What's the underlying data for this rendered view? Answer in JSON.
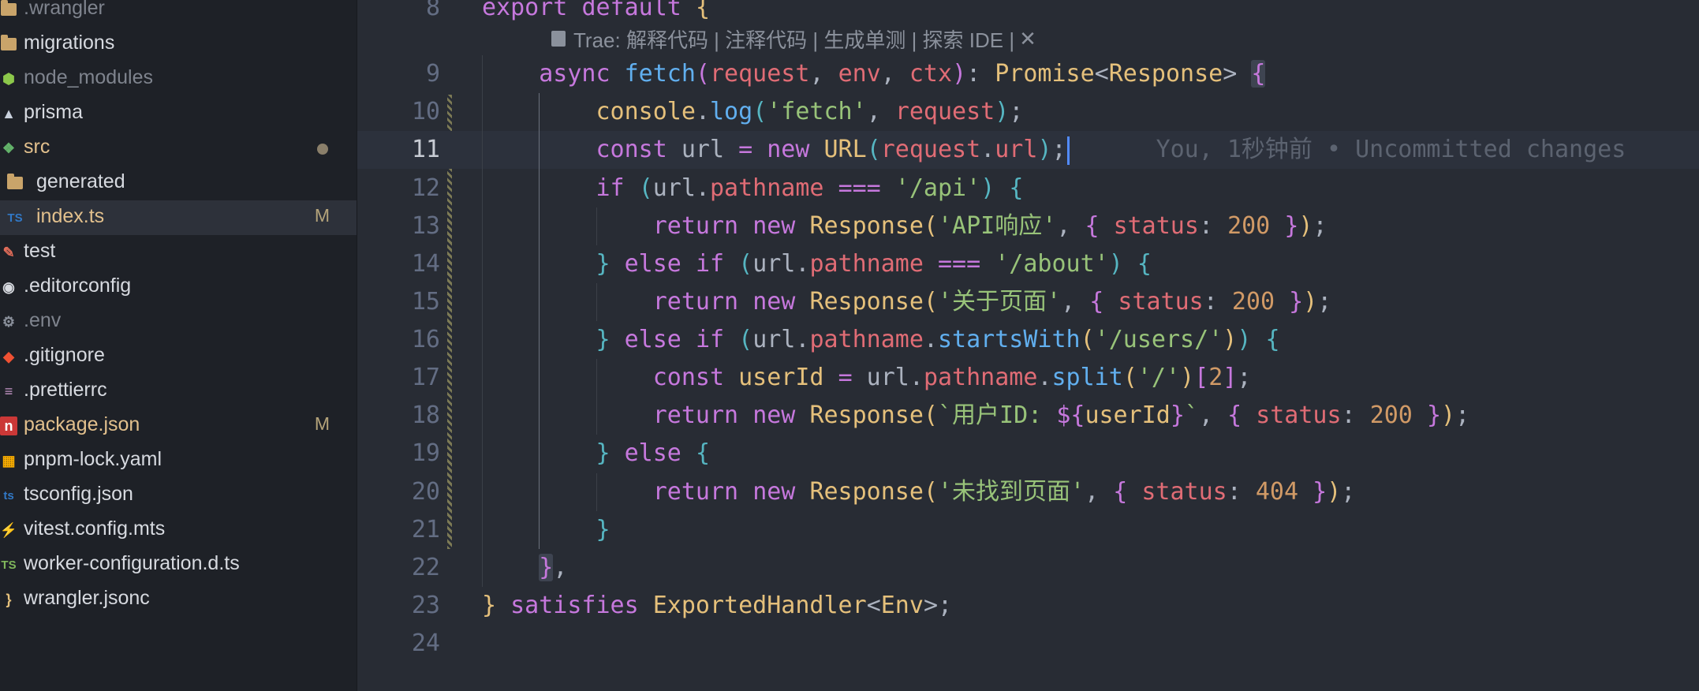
{
  "sidebar": {
    "items": [
      {
        "label": ".wrangler",
        "icon": "folder-icon",
        "muted": true,
        "badge": "",
        "dot": false,
        "child": false,
        "selected": false
      },
      {
        "label": "migrations",
        "icon": "folder-icon",
        "muted": false,
        "badge": "",
        "dot": false,
        "child": false,
        "selected": false
      },
      {
        "label": "node_modules",
        "icon": "node-icon",
        "muted": true,
        "badge": "",
        "dot": false,
        "child": false,
        "selected": false
      },
      {
        "label": "prisma",
        "icon": "prisma-icon",
        "muted": false,
        "badge": "",
        "dot": false,
        "child": false,
        "selected": false
      },
      {
        "label": "src",
        "icon": "src-folder-icon",
        "muted": false,
        "badge": "",
        "dot": true,
        "child": false,
        "selected": false,
        "yellow": true
      },
      {
        "label": "generated",
        "icon": "folder-icon",
        "muted": false,
        "badge": "",
        "dot": false,
        "child": true,
        "selected": false
      },
      {
        "label": "index.ts",
        "icon": "typescript-icon",
        "muted": false,
        "badge": "M",
        "dot": false,
        "child": true,
        "selected": true,
        "yellow": true
      },
      {
        "label": "test",
        "icon": "test-folder-icon",
        "muted": false,
        "badge": "",
        "dot": false,
        "child": false,
        "selected": false
      },
      {
        "label": ".editorconfig",
        "icon": "editorconfig-icon",
        "muted": false,
        "badge": "",
        "dot": false,
        "child": false,
        "selected": false
      },
      {
        "label": ".env",
        "icon": "gear-icon",
        "muted": true,
        "badge": "",
        "dot": false,
        "child": false,
        "selected": false
      },
      {
        "label": ".gitignore",
        "icon": "git-icon",
        "muted": false,
        "badge": "",
        "dot": false,
        "child": false,
        "selected": false
      },
      {
        "label": ".prettierrc",
        "icon": "prettier-icon",
        "muted": false,
        "badge": "",
        "dot": false,
        "child": false,
        "selected": false
      },
      {
        "label": "package.json",
        "icon": "npm-icon",
        "muted": false,
        "badge": "M",
        "dot": false,
        "child": false,
        "selected": false,
        "yellow": true
      },
      {
        "label": "pnpm-lock.yaml",
        "icon": "pnpm-icon",
        "muted": false,
        "badge": "",
        "dot": false,
        "child": false,
        "selected": false
      },
      {
        "label": "tsconfig.json",
        "icon": "tsconfig-icon",
        "muted": false,
        "badge": "",
        "dot": false,
        "child": false,
        "selected": false
      },
      {
        "label": "vitest.config.mts",
        "icon": "vitest-icon",
        "muted": false,
        "badge": "",
        "dot": false,
        "child": false,
        "selected": false
      },
      {
        "label": "worker-configuration.d.ts",
        "icon": "typescript-def-icon",
        "muted": false,
        "badge": "",
        "dot": false,
        "child": false,
        "selected": false
      },
      {
        "label": "wrangler.jsonc",
        "icon": "json-icon",
        "muted": false,
        "badge": "",
        "dot": false,
        "child": false,
        "selected": false
      }
    ]
  },
  "editor": {
    "codelens": "Trae: 解释代码 | 注释代码 | 生成单测 | 探索 IDE |",
    "codelens_close": "✕",
    "blame": "You, 1秒钟前 • Uncommitted changes",
    "current_line": "11",
    "lines": [
      {
        "num": "8",
        "tokens": [
          [
            "kw",
            "export"
          ],
          [
            "pl",
            " "
          ],
          [
            "kw",
            "default"
          ],
          [
            "pl",
            " "
          ],
          [
            "br1",
            "{"
          ]
        ]
      },
      {
        "num": "9",
        "tokens": [
          [
            "pl",
            "    "
          ],
          [
            "kw",
            "async"
          ],
          [
            "pl",
            " "
          ],
          [
            "fn",
            "fetch"
          ],
          [
            "br2",
            "("
          ],
          [
            "pm",
            "request"
          ],
          [
            "pl",
            ", "
          ],
          [
            "pm",
            "env"
          ],
          [
            "pl",
            ", "
          ],
          [
            "pm",
            "ctx"
          ],
          [
            "br2",
            ")"
          ],
          [
            "pl",
            ": "
          ],
          [
            "ty",
            "Promise"
          ],
          [
            "pl",
            "<"
          ],
          [
            "ty",
            "Response"
          ],
          [
            "pl",
            "> "
          ],
          [
            "br2 bracket-hl",
            "{"
          ]
        ]
      },
      {
        "num": "10",
        "tokens": [
          [
            "pl",
            "        "
          ],
          [
            "ty",
            "console"
          ],
          [
            "pl",
            "."
          ],
          [
            "fn",
            "log"
          ],
          [
            "br3",
            "("
          ],
          [
            "st",
            "'fetch'"
          ],
          [
            "pl",
            ", "
          ],
          [
            "pm",
            "request"
          ],
          [
            "br3",
            ")"
          ],
          [
            "pl",
            ";"
          ]
        ]
      },
      {
        "num": "11",
        "tokens": [
          [
            "pl",
            "        "
          ],
          [
            "kw",
            "const"
          ],
          [
            "pl",
            " url "
          ],
          [
            "kw",
            "="
          ],
          [
            "pl",
            " "
          ],
          [
            "kw",
            "new"
          ],
          [
            "pl",
            " "
          ],
          [
            "ty",
            "URL"
          ],
          [
            "br3",
            "("
          ],
          [
            "pm",
            "request"
          ],
          [
            "pl",
            "."
          ],
          [
            "pm",
            "url"
          ],
          [
            "br3",
            ")"
          ],
          [
            "pl",
            ";"
          ]
        ]
      },
      {
        "num": "12",
        "tokens": [
          [
            "pl",
            "        "
          ],
          [
            "kw",
            "if"
          ],
          [
            "pl",
            " "
          ],
          [
            "br3",
            "("
          ],
          [
            "pl",
            "url."
          ],
          [
            "pm",
            "pathname"
          ],
          [
            "pl",
            " "
          ],
          [
            "kw",
            "==="
          ],
          [
            "pl",
            " "
          ],
          [
            "st",
            "'/api'"
          ],
          [
            "br3",
            ")"
          ],
          [
            "pl",
            " "
          ],
          [
            "br3",
            "{"
          ]
        ]
      },
      {
        "num": "13",
        "tokens": [
          [
            "pl",
            "            "
          ],
          [
            "kw",
            "return"
          ],
          [
            "pl",
            " "
          ],
          [
            "kw",
            "new"
          ],
          [
            "pl",
            " "
          ],
          [
            "ty",
            "Response"
          ],
          [
            "br1",
            "("
          ],
          [
            "st",
            "'API响应'"
          ],
          [
            "pl",
            ", "
          ],
          [
            "br2",
            "{"
          ],
          [
            "pl",
            " "
          ],
          [
            "pm",
            "status"
          ],
          [
            "pl",
            ": "
          ],
          [
            "nu",
            "200"
          ],
          [
            "pl",
            " "
          ],
          [
            "br2",
            "}"
          ],
          [
            "br1",
            ")"
          ],
          [
            "pl",
            ";"
          ]
        ]
      },
      {
        "num": "14",
        "tokens": [
          [
            "pl",
            "        "
          ],
          [
            "br3",
            "}"
          ],
          [
            "pl",
            " "
          ],
          [
            "kw",
            "else"
          ],
          [
            "pl",
            " "
          ],
          [
            "kw",
            "if"
          ],
          [
            "pl",
            " "
          ],
          [
            "br3",
            "("
          ],
          [
            "pl",
            "url."
          ],
          [
            "pm",
            "pathname"
          ],
          [
            "pl",
            " "
          ],
          [
            "kw",
            "==="
          ],
          [
            "pl",
            " "
          ],
          [
            "st",
            "'/about'"
          ],
          [
            "br3",
            ")"
          ],
          [
            "pl",
            " "
          ],
          [
            "br3",
            "{"
          ]
        ]
      },
      {
        "num": "15",
        "tokens": [
          [
            "pl",
            "            "
          ],
          [
            "kw",
            "return"
          ],
          [
            "pl",
            " "
          ],
          [
            "kw",
            "new"
          ],
          [
            "pl",
            " "
          ],
          [
            "ty",
            "Response"
          ],
          [
            "br1",
            "("
          ],
          [
            "st",
            "'关于页面'"
          ],
          [
            "pl",
            ", "
          ],
          [
            "br2",
            "{"
          ],
          [
            "pl",
            " "
          ],
          [
            "pm",
            "status"
          ],
          [
            "pl",
            ": "
          ],
          [
            "nu",
            "200"
          ],
          [
            "pl",
            " "
          ],
          [
            "br2",
            "}"
          ],
          [
            "br1",
            ")"
          ],
          [
            "pl",
            ";"
          ]
        ]
      },
      {
        "num": "16",
        "tokens": [
          [
            "pl",
            "        "
          ],
          [
            "br3",
            "}"
          ],
          [
            "pl",
            " "
          ],
          [
            "kw",
            "else"
          ],
          [
            "pl",
            " "
          ],
          [
            "kw",
            "if"
          ],
          [
            "pl",
            " "
          ],
          [
            "br3",
            "("
          ],
          [
            "pl",
            "url."
          ],
          [
            "pm",
            "pathname"
          ],
          [
            "pl",
            "."
          ],
          [
            "fn",
            "startsWith"
          ],
          [
            "br1",
            "("
          ],
          [
            "st",
            "'/users/'"
          ],
          [
            "br1",
            ")"
          ],
          [
            "br3",
            ")"
          ],
          [
            "pl",
            " "
          ],
          [
            "br3",
            "{"
          ]
        ]
      },
      {
        "num": "17",
        "tokens": [
          [
            "pl",
            "            "
          ],
          [
            "kw",
            "const"
          ],
          [
            "pl",
            " "
          ],
          [
            "ty",
            "userId"
          ],
          [
            "pl",
            " "
          ],
          [
            "kw",
            "="
          ],
          [
            "pl",
            " url."
          ],
          [
            "pm",
            "pathname"
          ],
          [
            "pl",
            "."
          ],
          [
            "fn",
            "split"
          ],
          [
            "br1",
            "("
          ],
          [
            "st",
            "'/'"
          ],
          [
            "br1",
            ")"
          ],
          [
            "br2",
            "["
          ],
          [
            "nu",
            "2"
          ],
          [
            "br2",
            "]"
          ],
          [
            "pl",
            ";"
          ]
        ]
      },
      {
        "num": "18",
        "tokens": [
          [
            "pl",
            "            "
          ],
          [
            "kw",
            "return"
          ],
          [
            "pl",
            " "
          ],
          [
            "kw",
            "new"
          ],
          [
            "pl",
            " "
          ],
          [
            "ty",
            "Response"
          ],
          [
            "br1",
            "("
          ],
          [
            "st",
            "`用户ID: "
          ],
          [
            "kw",
            "${"
          ],
          [
            "ty",
            "userId"
          ],
          [
            "kw",
            "}"
          ],
          [
            "st",
            "`"
          ],
          [
            "pl",
            ", "
          ],
          [
            "br2",
            "{"
          ],
          [
            "pl",
            " "
          ],
          [
            "pm",
            "status"
          ],
          [
            "pl",
            ": "
          ],
          [
            "nu",
            "200"
          ],
          [
            "pl",
            " "
          ],
          [
            "br2",
            "}"
          ],
          [
            "br1",
            ")"
          ],
          [
            "pl",
            ";"
          ]
        ]
      },
      {
        "num": "19",
        "tokens": [
          [
            "pl",
            "        "
          ],
          [
            "br3",
            "}"
          ],
          [
            "pl",
            " "
          ],
          [
            "kw",
            "else"
          ],
          [
            "pl",
            " "
          ],
          [
            "br3",
            "{"
          ]
        ]
      },
      {
        "num": "20",
        "tokens": [
          [
            "pl",
            "            "
          ],
          [
            "kw",
            "return"
          ],
          [
            "pl",
            " "
          ],
          [
            "kw",
            "new"
          ],
          [
            "pl",
            " "
          ],
          [
            "ty",
            "Response"
          ],
          [
            "br1",
            "("
          ],
          [
            "st",
            "'未找到页面'"
          ],
          [
            "pl",
            ", "
          ],
          [
            "br2",
            "{"
          ],
          [
            "pl",
            " "
          ],
          [
            "pm",
            "status"
          ],
          [
            "pl",
            ": "
          ],
          [
            "nu",
            "404"
          ],
          [
            "pl",
            " "
          ],
          [
            "br2",
            "}"
          ],
          [
            "br1",
            ")"
          ],
          [
            "pl",
            ";"
          ]
        ]
      },
      {
        "num": "21",
        "tokens": [
          [
            "pl",
            "        "
          ],
          [
            "br3",
            "}"
          ]
        ]
      },
      {
        "num": "22",
        "tokens": [
          [
            "pl",
            "    "
          ],
          [
            "br2 bracket-hl",
            "}"
          ],
          [
            "pl",
            ","
          ]
        ]
      },
      {
        "num": "23",
        "tokens": [
          [
            "br1",
            "}"
          ],
          [
            "pl",
            " "
          ],
          [
            "kw",
            "satisfies"
          ],
          [
            "pl",
            " "
          ],
          [
            "ty",
            "ExportedHandler"
          ],
          [
            "pl",
            "<"
          ],
          [
            "ty",
            "Env"
          ],
          [
            "pl",
            ">;"
          ]
        ]
      },
      {
        "num": "24",
        "tokens": []
      }
    ]
  },
  "colors": {
    "background": "#282c34",
    "sidebar": "#1e2127",
    "keyword": "#c678dd",
    "function": "#61afef",
    "string": "#98c379",
    "type": "#e5c07b",
    "param": "#e06c75",
    "number": "#d19a66",
    "cursor": "#528bff"
  }
}
